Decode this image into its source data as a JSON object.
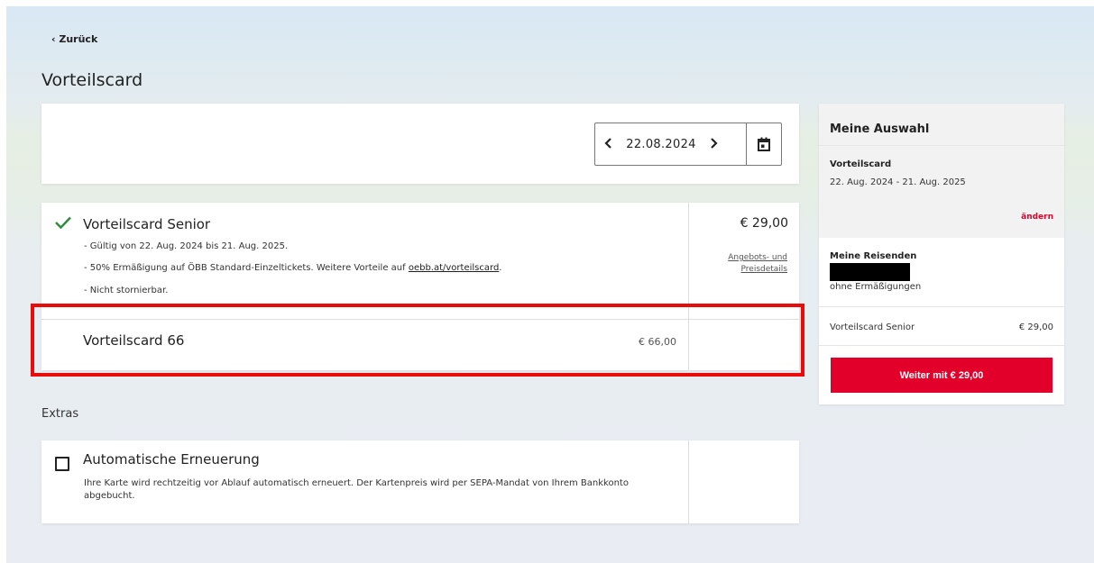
{
  "nav": {
    "back_label": "‹ Zurück"
  },
  "page": {
    "title": "Vorteilscard"
  },
  "date_picker": {
    "date": "22.08.2024",
    "prev_icon": "chevron-left-icon",
    "next_icon": "chevron-right-icon",
    "calendar_icon": "calendar-icon"
  },
  "products": [
    {
      "title": "Vorteilscard Senior",
      "price": "€ 29,00",
      "selected": true,
      "bullets": [
        "- Gültig von 22. Aug. 2024 bis 21. Aug. 2025.",
        "- 50% Ermäßigung auf ÖBB Standard-Einzeltickets. Weitere Vorteile auf ",
        "- Nicht stornierbar."
      ],
      "link_text": "oebb.at/vorteilscard",
      "link_suffix": ".",
      "details_line1": "Angebots- und",
      "details_line2": "Preisdetails"
    },
    {
      "title": "Vorteilscard 66",
      "price": "€ 66,00",
      "selected": false
    }
  ],
  "extras": {
    "heading": "Extras",
    "item": {
      "title": "Automatische Erneuerung",
      "checked": false,
      "description": "Ihre Karte wird rechtzeitig vor Ablauf automatisch erneuert. Der Kartenpreis wird per SEPA-Mandat von Ihrem Bankkonto abgebucht."
    }
  },
  "sidebar": {
    "title": "Meine Auswahl",
    "selection_label": "Vorteilscard",
    "selection_dates": "22. Aug. 2024 - 21. Aug. 2025",
    "change_label": "ändern",
    "travelers_label": "Meine Reisenden",
    "travelers_discount": "ohne Ermäßigungen",
    "line_item_name": "Vorteilscard Senior",
    "line_item_price": "€ 29,00",
    "continue_label": "Weiter mit € 29,00"
  },
  "colors": {
    "accent_red": "#e2002a",
    "highlight_red": "#ea0b0b",
    "check_green": "#2e8b3a"
  }
}
